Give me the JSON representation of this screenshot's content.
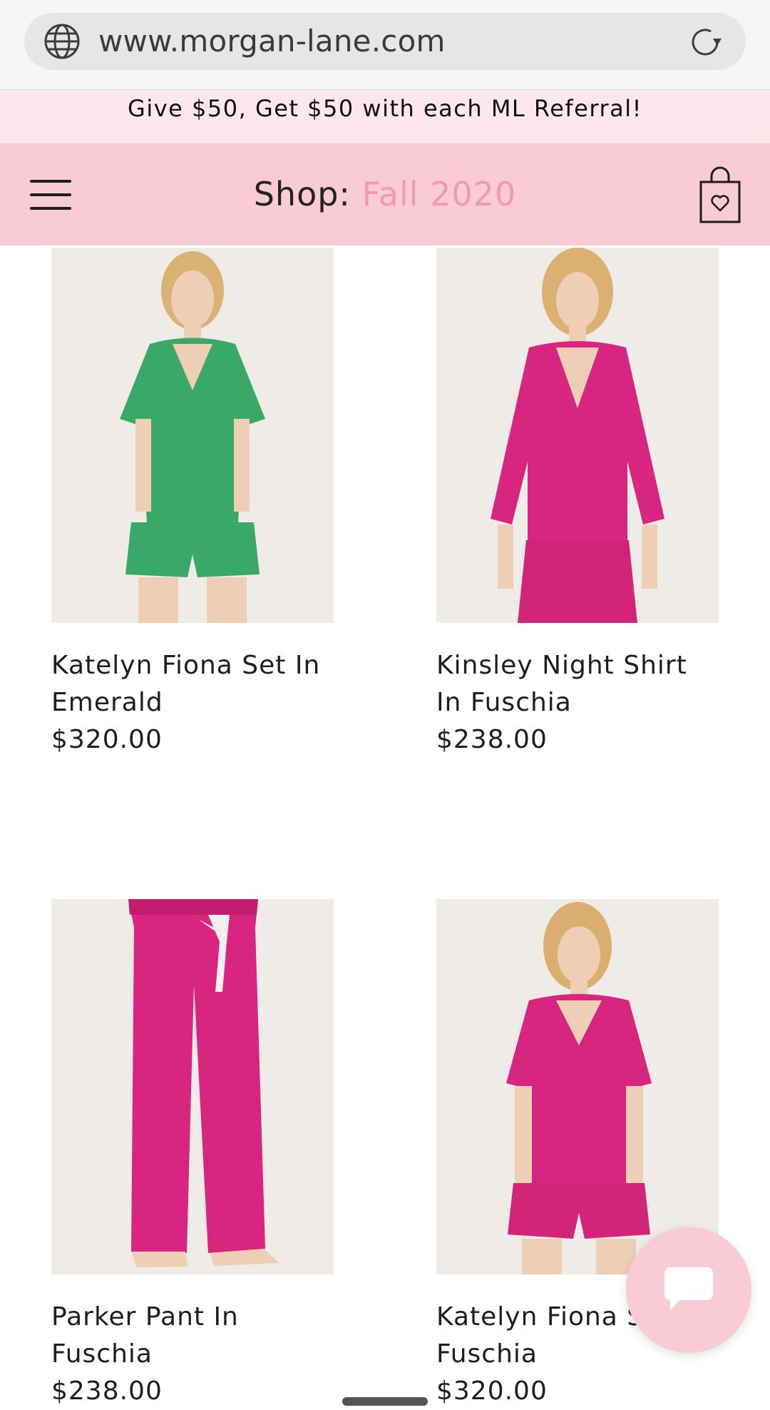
{
  "browser": {
    "url": "www.morgan-lane.com",
    "globe_icon": "globe-icon",
    "reload_icon": "reload-icon"
  },
  "promo": {
    "text": "Give $50, Get $50 with each ML Referral!"
  },
  "header": {
    "title_prefix": "Shop: ",
    "title_season": "Fall 2020",
    "menu_icon": "hamburger-menu-icon",
    "bag_icon": "shopping-bag-heart-icon"
  },
  "colors": {
    "header_bg": "#f8cbd6",
    "promo_bg": "#fce8ec",
    "accent": "#f29aab",
    "emerald": "#3aa866",
    "fuschia": "#d8257f"
  },
  "products": [
    {
      "name": "Katelyn Fiona Set In Emerald",
      "price": "$320.00"
    },
    {
      "name": "Kinsley Night Shirt In Fuschia",
      "price": "$238.00"
    },
    {
      "name": "Parker Pant In Fuschia",
      "price": "$238.00"
    },
    {
      "name": "Katelyn Fiona Set In Fuschia",
      "price": "$320.00"
    }
  ],
  "chat": {
    "icon": "chat-bubble-icon"
  }
}
